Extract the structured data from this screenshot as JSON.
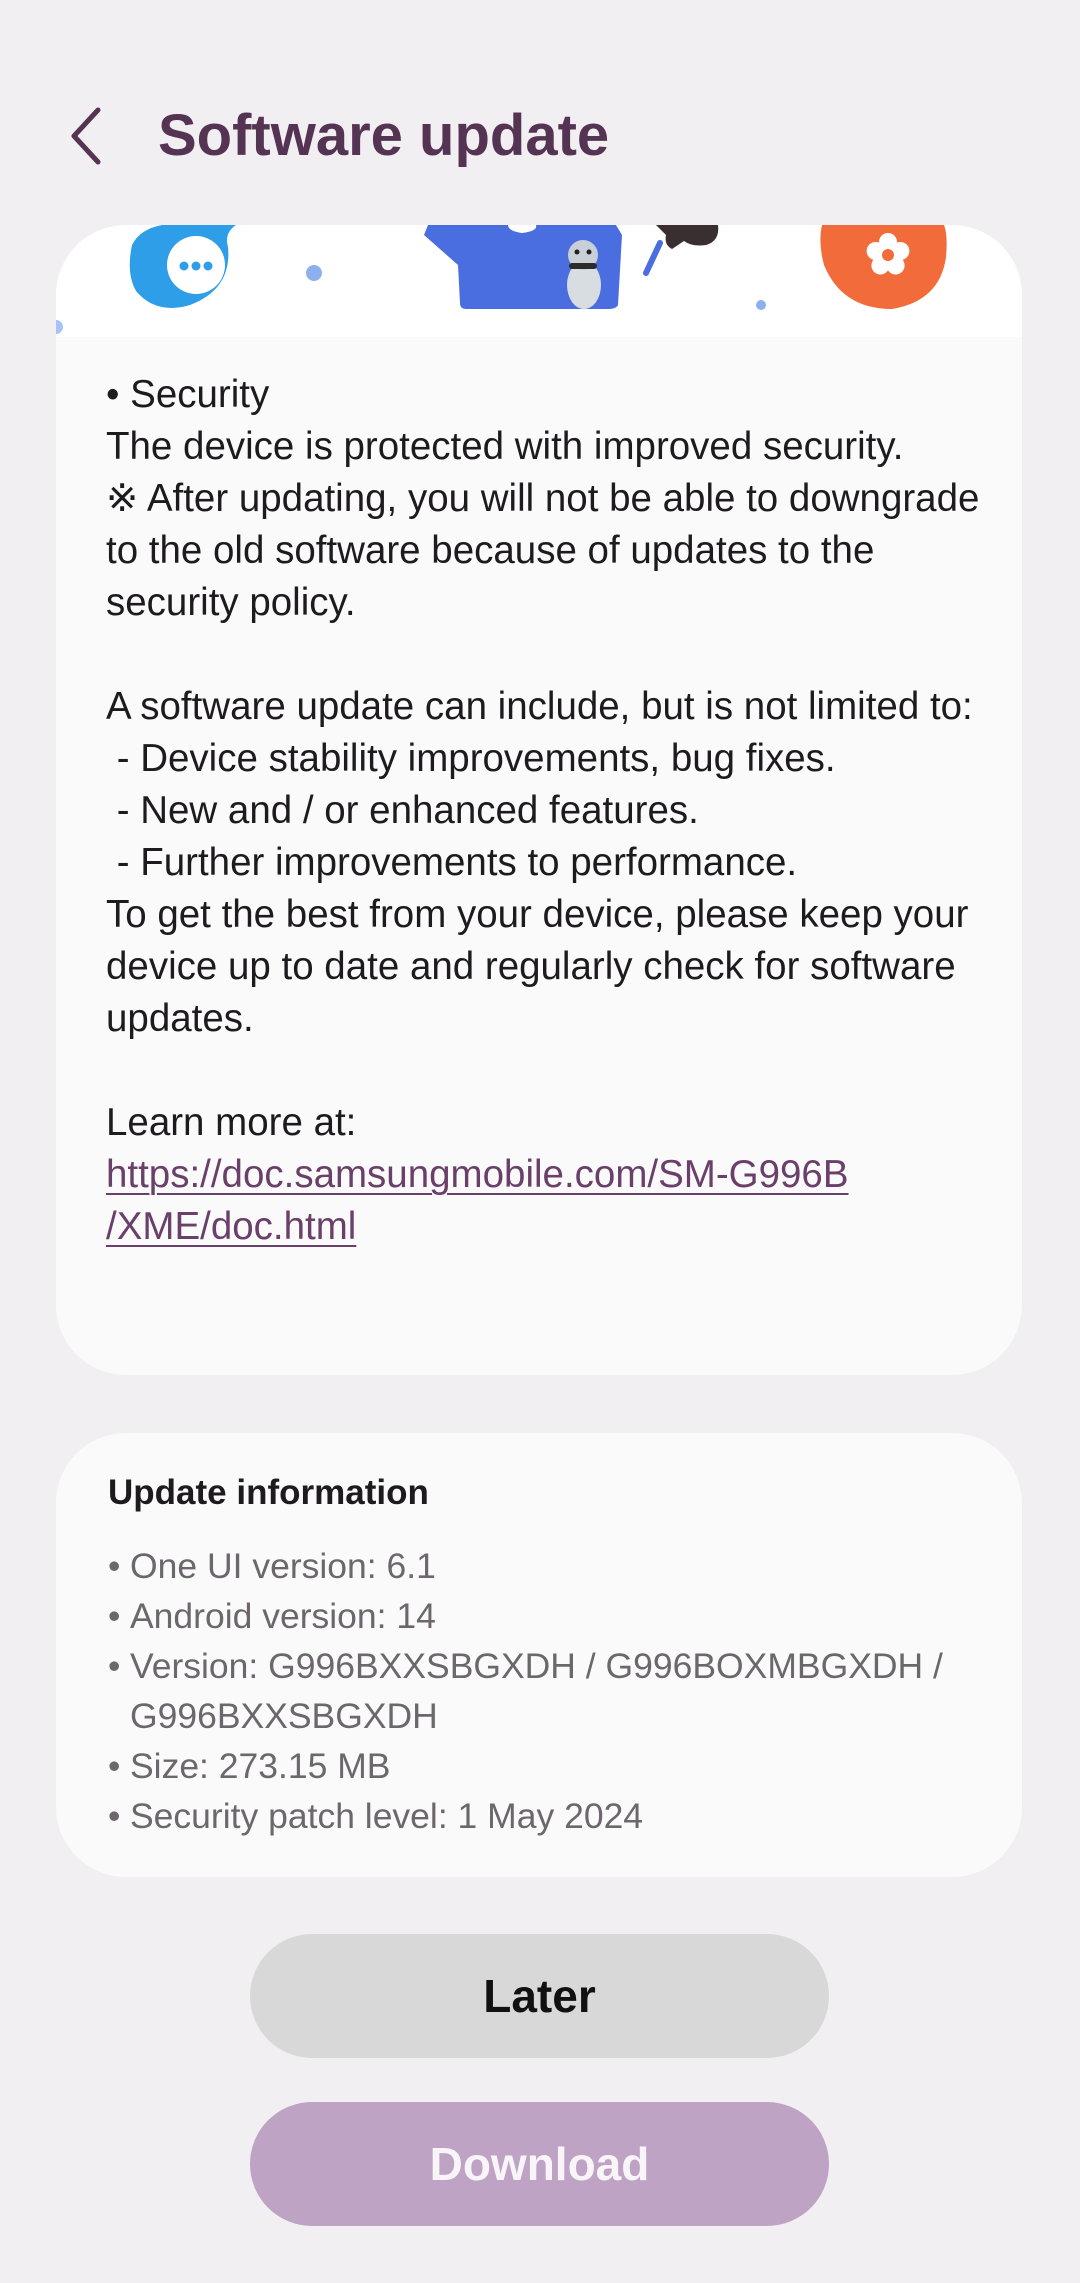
{
  "header": {
    "title": "Software update"
  },
  "release_notes": {
    "section_heading": "• Security",
    "security_lines": [
      "The device is protected with improved security.",
      "※ After updating, you will not be able to downgrade to the old software because of updates to the security policy."
    ],
    "intro": "A software update can include, but is not limited to:",
    "items": [
      " - Device stability improvements, bug fixes.",
      " - New and / or enhanced features.",
      " - Further improvements to performance."
    ],
    "closing": "To get the best from your device, please keep your device up to date and regularly check for software updates.",
    "learn_more_label": "Learn more at:",
    "learn_more_link_line1": "https://doc.samsungmobile.com/SM-G996B",
    "learn_more_link_line2": "/XME/doc.html"
  },
  "update_info": {
    "title": "Update information",
    "items": [
      "One UI version: 6.1",
      "Android version: 14",
      "Version: G996BXXSBGXDH / G996BOXMBGXDH / G996BXXSBGXDH",
      "Size: 273.15 MB",
      "Security patch level: 1 May 2024"
    ]
  },
  "buttons": {
    "later": "Later",
    "download": "Download"
  },
  "colors": {
    "background": "#f2eff3",
    "title": "#553453",
    "link": "#6a3f69",
    "download_button": "#bea3c4",
    "later_button": "#d9d8d9"
  },
  "icons": {
    "back": "chevron-left-icon",
    "banner_chat": "chat-bubble-icon",
    "banner_flower": "flower-icon",
    "banner_illustration": "character-illustration"
  }
}
